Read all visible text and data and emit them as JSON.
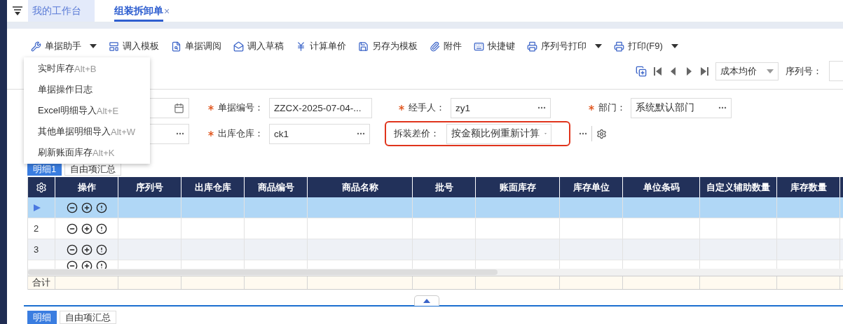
{
  "tabs": [
    {
      "label": "我的工作台",
      "selected": false
    },
    {
      "label": "组装拆卸单",
      "selected": true,
      "close": "×"
    }
  ],
  "toolbar": [
    {
      "label": "单据助手",
      "dropdown": true
    },
    {
      "label": "调入模板",
      "dropdown": false
    },
    {
      "label": "单据调阅",
      "dropdown": false
    },
    {
      "label": "调入草稿",
      "dropdown": false
    },
    {
      "label": "计算单价",
      "dropdown": false
    },
    {
      "label": "另存为模板",
      "dropdown": false
    },
    {
      "label": "附件",
      "dropdown": false
    },
    {
      "label": "快捷键",
      "dropdown": false
    },
    {
      "label": "序列号打印",
      "dropdown": true
    },
    {
      "label": "打印(F9)",
      "dropdown": true
    }
  ],
  "menu": [
    {
      "label": "实时库存",
      "shortcut": "Alt+B"
    },
    {
      "label": "单据操作日志"
    },
    {
      "label": "Excel明细导入",
      "shortcut": "Alt+E"
    },
    {
      "label": "其他单据明细导入",
      "shortcut": "Alt+W"
    },
    {
      "label": "刷新账面库存",
      "shortcut": "Alt+K"
    }
  ],
  "navigator": {
    "price_select": "成本均价",
    "serial_label": "序列号："
  },
  "form": {
    "rows": [
      [
        {
          "kind": "date"
        },
        {
          "kind": "text",
          "label": "单据编号：",
          "required": true,
          "value": "ZZCX-2025-07-04-..."
        },
        {
          "kind": "lookup",
          "label": "经手人：",
          "required": true,
          "value": "zy1"
        },
        {
          "kind": "lookup",
          "label": "部门：",
          "required": true,
          "value": "系统默认部门"
        }
      ],
      [
        {
          "kind": "lookup"
        },
        {
          "kind": "lookup",
          "label": "出库仓库：",
          "required": true,
          "value": "ck1"
        },
        {
          "kind": "select",
          "label": "拆装差价：",
          "required": false,
          "value": "按金额比例重新计算",
          "highlighted": true
        }
      ]
    ]
  },
  "detail_tabs": [
    {
      "label": "明细1",
      "selected": true
    },
    {
      "label": "自由项汇总",
      "selected": false
    }
  ],
  "table": {
    "columns": [
      "操作",
      "序列号",
      "出库仓库",
      "商品编号",
      "商品名称",
      "批号",
      "账面库存",
      "库存单位",
      "单位条码",
      "自定义辅助数量",
      "库存数量"
    ],
    "rows": [
      {
        "selected": true
      },
      {
        "label": "2",
        "selected": false
      },
      {
        "label": "3",
        "selected": false
      },
      {
        "selected": false,
        "kind": "partial"
      }
    ],
    "total_label": "合计"
  },
  "bottom_tabs": [
    {
      "label": "明细",
      "selected": true
    },
    {
      "label": "自由项汇总",
      "selected": false
    }
  ]
}
